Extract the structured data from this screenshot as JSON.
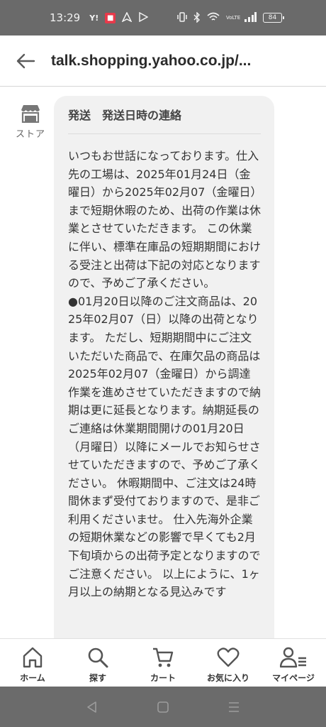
{
  "status_bar": {
    "time": "13:29",
    "icons_left": [
      "yahoo-notification-icon",
      "app-notification-icon",
      "navigation-icon",
      "play-icon"
    ],
    "icons_right": [
      "vibrate-icon",
      "bluetooth-icon",
      "wifi-icon",
      "volte-icon",
      "signal-icon",
      "battery-icon"
    ],
    "yahoo_text": "Y!",
    "volte_text": "VoLTE",
    "battery_level": "84"
  },
  "browser": {
    "url": "talk.shopping.yahoo.co.jp/..."
  },
  "chat": {
    "sender_label": "ストア",
    "message": {
      "title": "発送　発送日時の連絡",
      "body": "いつもお世話になっております。仕入先の工場は、2025年01月24日（金曜日）から2025年02月07（金曜日）まで短期休暇のため、出荷の作業は休業とさせていただきます。 この休業に伴い、標準在庫品の短期期間における受注と出荷は下記の対応となりますので、予めご了承ください。\n●01月20日以降のご注文商品は、2025年02月07（日）以降の出荷となります。 ただし、短期期間中にご注文いただいた商品で、在庫欠品の商品は2025年02月07（金曜日）から調達作業を進めさせていただきますので納期は更に延長となります。納期延長のご連絡は休業期間開けの01月20日（月曜日）以降にメールでお知らせさせていただきますので、予めご了承ください。 休暇期間中、ご注文は24時間休まず受付ておりますので、是非ご利用くださいませ。 仕入先海外企業の短期休業などの影響で早くても2月下旬頃からの出荷予定となりますのでご注意ください。 以上にように、1ヶ月以上の納期となる見込みです"
    }
  },
  "bottom_nav": {
    "items": [
      {
        "label": "ホーム",
        "icon": "home-icon"
      },
      {
        "label": "探す",
        "icon": "search-icon"
      },
      {
        "label": "カート",
        "icon": "cart-icon"
      },
      {
        "label": "お気に入り",
        "icon": "heart-icon"
      },
      {
        "label": "マイページ",
        "icon": "user-icon"
      }
    ]
  },
  "system_nav": {
    "buttons": [
      "back-triangle-icon",
      "home-square-icon",
      "recents-icon"
    ]
  },
  "colors": {
    "status_bar_bg": "#6a6a6a",
    "bubble_bg": "#f1f1f1",
    "system_nav_bg": "#6b6b6b",
    "notification_red": "#e8394a"
  }
}
